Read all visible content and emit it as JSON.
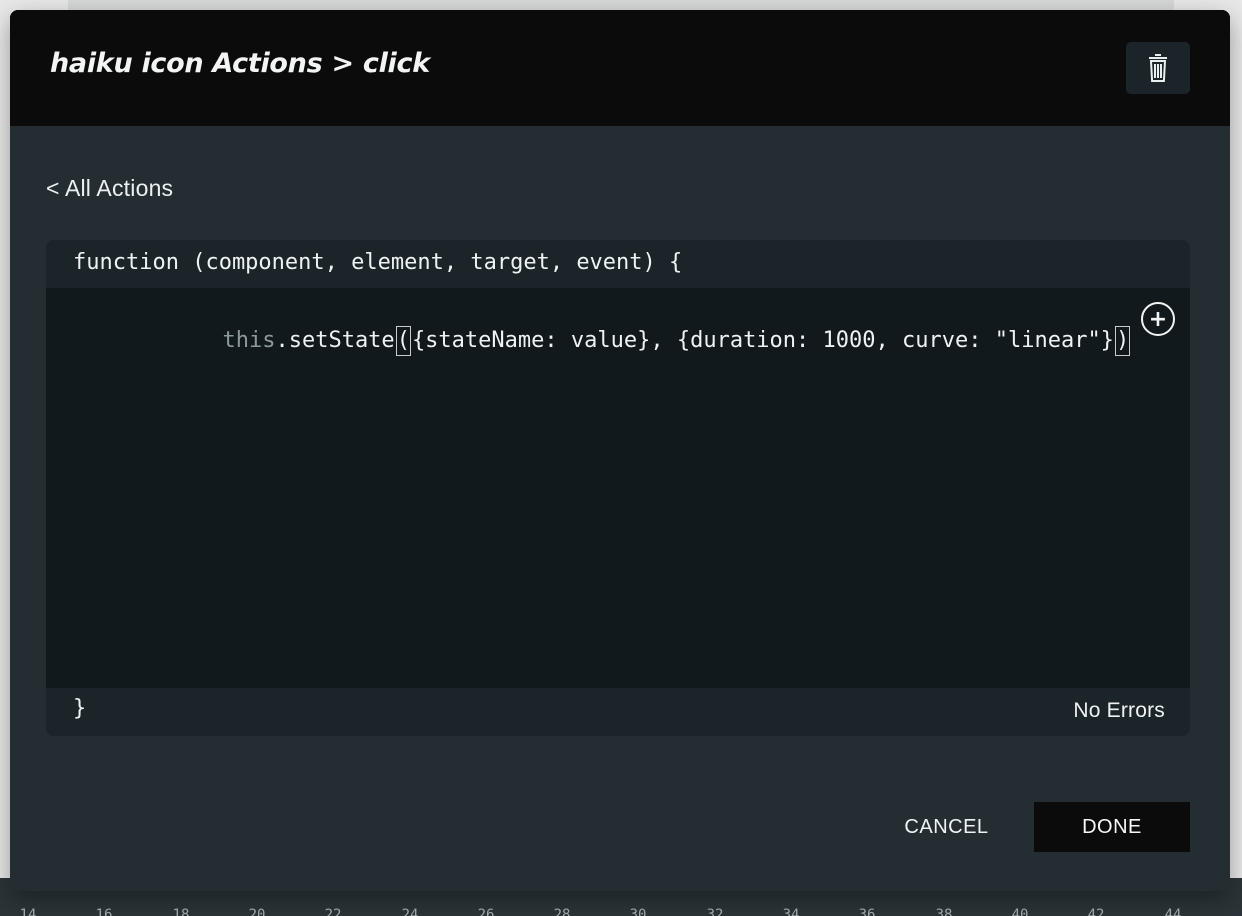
{
  "modal": {
    "title": "haiku icon Actions > click",
    "back_link": "< All Actions",
    "icons": {
      "delete": "trash-icon",
      "add": "plus-circle-icon"
    },
    "colors": {
      "header": "#0b0b0c",
      "panel": "#232d32",
      "editor": "#11191c",
      "text": "#f1f3f3",
      "muted_code": "#8b9aa1"
    }
  },
  "editor": {
    "signature": "function (component, element, target, event) {",
    "code": {
      "this_keyword": "this",
      "method": ".setState",
      "open_paren": "(",
      "arguments": "{stateName: value}, {duration: 1000, curve: \"linear\"}",
      "close_paren": ")"
    },
    "closing_brace": "}",
    "status": "No Errors"
  },
  "buttons": {
    "cancel": "CANCEL",
    "done": "DONE"
  },
  "timeline": {
    "ticks": [
      "14",
      "16",
      "18",
      "20",
      "22",
      "24",
      "26",
      "28",
      "30",
      "32",
      "34",
      "36",
      "38",
      "40",
      "42",
      "44"
    ]
  }
}
